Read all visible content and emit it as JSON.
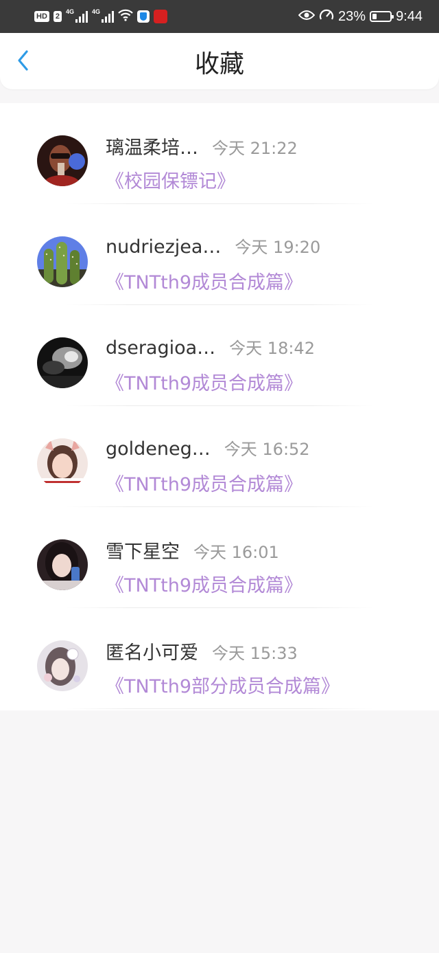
{
  "status_bar": {
    "hd": "HD",
    "sim": "2",
    "net1": "4G",
    "net2": "4G",
    "battery_percent": "23%",
    "battery_level": 0.23,
    "time": "9:44"
  },
  "header": {
    "title": "收藏",
    "back_icon": "chevron-left-icon",
    "accent_color": "#2e9be6"
  },
  "items": [
    {
      "name": "璃温柔培…",
      "time": "今天 21:22",
      "story": "《校园保镖记》"
    },
    {
      "name": "nudriezjea…",
      "time": "今天 19:20",
      "story": "《TNTth9成员合成篇》"
    },
    {
      "name": "dseragioa…",
      "time": "今天 18:42",
      "story": "《TNTth9成员合成篇》"
    },
    {
      "name": "goldeneg…",
      "time": "今天 16:52",
      "story": "《TNTth9成员合成篇》"
    },
    {
      "name": "雪下星空",
      "time": "今天 16:01",
      "story": "《TNTth9成员合成篇》"
    },
    {
      "name": "匿名小可爱",
      "time": "今天 15:33",
      "story": "《TNTth9部分成员合成篇》"
    }
  ],
  "colors": {
    "story_link": "#b289d6",
    "time_text": "#9a9a9a",
    "name_text": "#333333"
  }
}
